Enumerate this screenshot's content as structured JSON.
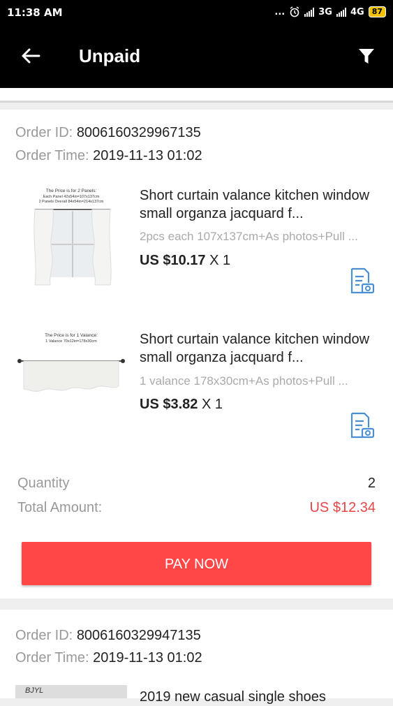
{
  "status_bar": {
    "time": "11:38 AM",
    "dots": "...",
    "net1": "3G",
    "net2": "4G",
    "battery": "87"
  },
  "header": {
    "title": "Unpaid"
  },
  "orders": [
    {
      "id_label": "Order ID:",
      "id_value": "8006160329967135",
      "time_label": "Order Time:",
      "time_value": "2019-11-13 01:02",
      "items": [
        {
          "name": "Short curtain valance kitchen window small organza jacquard f...",
          "sku": "2pcs each 107x137cm+As photos+Pull ...",
          "price": "US $10.17",
          "qty": "X 1",
          "thumb_caption1": "The Price is for 2 Panels:",
          "thumb_caption2": "Each Panel 42x54in=107x137cm",
          "thumb_caption3": "2 Panels Overall 84x54in=214x137cm"
        },
        {
          "name": "Short curtain valance kitchen window small organza jacquard f...",
          "sku": "1 valance 178x30cm+As photos+Pull ...",
          "price": "US $3.82",
          "qty": "X 1",
          "thumb_caption1": "The Price is for 1 Valance:",
          "thumb_caption2": "1 Valance  70x12in=178x30cm"
        }
      ],
      "quantity_label": "Quantity",
      "quantity_value": "2",
      "total_label": "Total Amount:",
      "total_value": "US $12.34",
      "pay_label": "PAY NOW"
    },
    {
      "id_label": "Order ID:",
      "id_value": "8006160329947135",
      "time_label": "Order Time:",
      "time_value": "2019-11-13 01:02",
      "items": [
        {
          "name": "2019 new casual single shoes",
          "thumb_text": "BJYL"
        }
      ]
    }
  ],
  "colors": {
    "accent": "#ff4747",
    "total": "#e54545",
    "icon_blue": "#4a8fd6"
  }
}
